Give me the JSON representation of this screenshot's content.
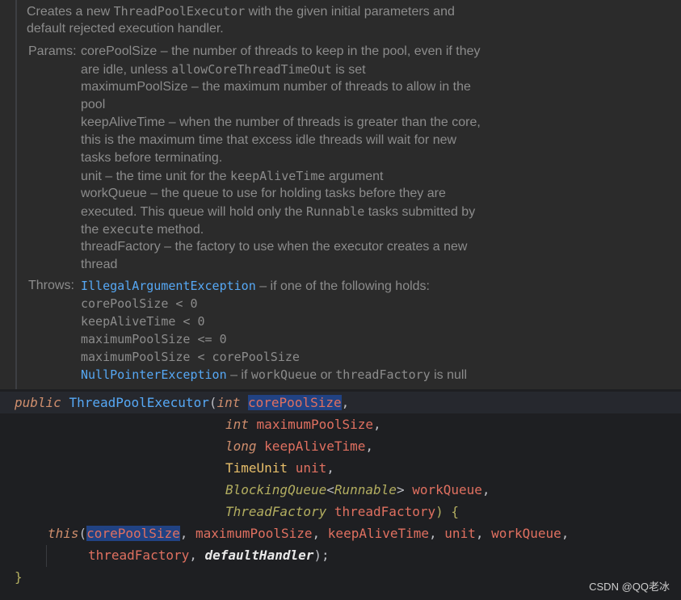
{
  "doc": {
    "intro_line1_a": "Creates a new ",
    "intro_line1_code": "ThreadPoolExecutor",
    "intro_line1_b": " with the given initial parameters and",
    "intro_line2": "default rejected execution handler.",
    "params_label": "Params:",
    "params": [
      "corePoolSize – the number of threads to keep in the pool, even if they",
      [
        "are idle, unless ",
        "allowCoreThreadTimeOut",
        " is set"
      ],
      "maximumPoolSize – the maximum number of threads to allow in the",
      "pool",
      "keepAliveTime – when the number of threads is greater than the core,",
      "this is the maximum time that excess idle threads will wait for new",
      "tasks before terminating.",
      [
        "unit – the time unit for the ",
        "keepAliveTime",
        " argument"
      ],
      "workQueue – the queue to use for holding tasks before they are",
      [
        "executed. This queue will hold only the ",
        "Runnable",
        " tasks submitted by"
      ],
      [
        "the ",
        "execute",
        " method."
      ],
      "threadFactory – the factory to use when the executor creates a new",
      "thread"
    ],
    "throws_label": "Throws:",
    "throws_ex1": "IllegalArgumentException",
    "throws_ex1_desc": " – if one of the following holds:",
    "conditions": [
      "corePoolSize < 0",
      "keepAliveTime < 0",
      "maximumPoolSize <= 0",
      "maximumPoolSize < corePoolSize"
    ],
    "throws_ex2": "NullPointerException",
    "throws_ex2_a": " – if ",
    "throws_ex2_code1": "workQueue",
    "throws_ex2_b": " or ",
    "throws_ex2_code2": "threadFactory",
    "throws_ex2_c": " is null"
  },
  "code": {
    "public": "public",
    "ctor": "ThreadPoolExecutor",
    "int": "int",
    "long": "long",
    "p_core": "corePoolSize",
    "p_max": "maximumPoolSize",
    "p_keep": "keepAliveTime",
    "t_timeunit": "TimeUnit",
    "p_unit": "unit",
    "t_bq": "BlockingQueue",
    "t_runnable": "Runnable",
    "p_wq": "workQueue",
    "t_tf": "ThreadFactory",
    "p_tf": "threadFactory",
    "this": "this",
    "default_handler": "defaultHandler"
  },
  "watermark": "CSDN @QQ老冰"
}
